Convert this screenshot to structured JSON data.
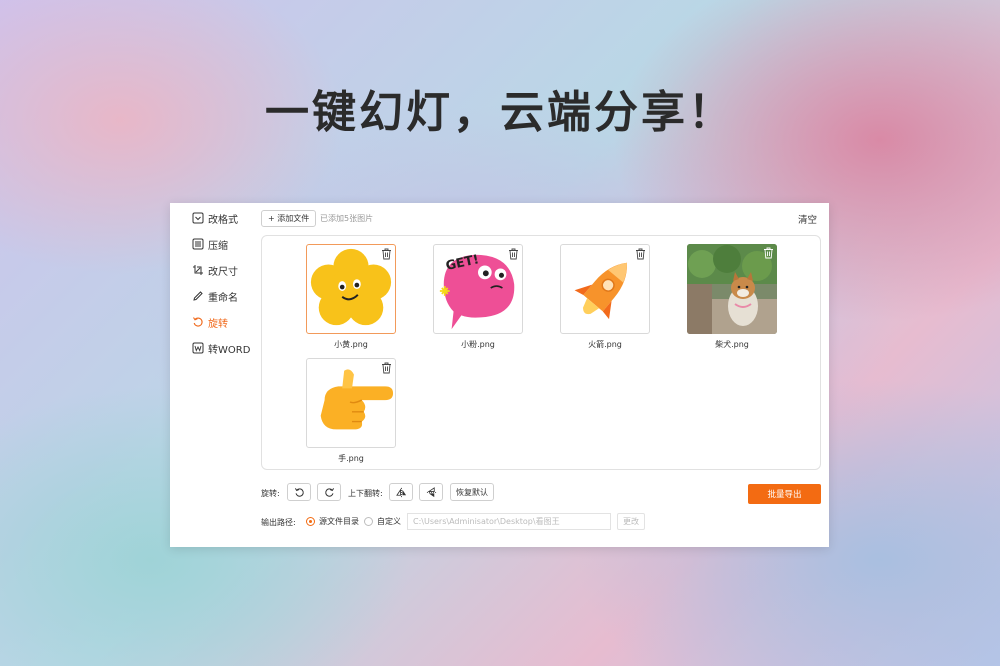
{
  "headline": "一键幻灯，云端分享！",
  "sidebar": {
    "items": [
      {
        "label": "改格式",
        "icon": "format-icon",
        "active": false
      },
      {
        "label": "压缩",
        "icon": "compress-icon",
        "active": false
      },
      {
        "label": "改尺寸",
        "icon": "resize-icon",
        "active": false
      },
      {
        "label": "重命名",
        "icon": "rename-pen-icon",
        "active": false
      },
      {
        "label": "旋转",
        "icon": "rotate-icon",
        "active": true
      },
      {
        "label": "转WORD",
        "icon": "word-icon",
        "active": false
      }
    ]
  },
  "toolbar": {
    "add_file_label": "+ 添加文件",
    "count_text": "已添加5张图片",
    "clear_label": "清空"
  },
  "files": [
    {
      "name": "小黄.png",
      "icon": "yellow-flower-sticker",
      "selected": true
    },
    {
      "name": "小粉.png",
      "icon": "pink-get-sticker",
      "selected": false
    },
    {
      "name": "火箭.png",
      "icon": "rocket-sticker",
      "selected": false
    },
    {
      "name": "柴犬.png",
      "icon": "shiba-photo",
      "selected": false
    },
    {
      "name": "手.png",
      "icon": "pointing-hand-sticker",
      "selected": false
    }
  ],
  "controls": {
    "rotate_label": "旋转:",
    "flip_label": "上下翻转:",
    "reset_label": "恢复默认",
    "export_label": "批量导出",
    "output_label": "输出路径:",
    "source_dir_label": "源文件目录",
    "custom_label": "自定义",
    "path_placeholder": "C:\\Users\\Adminisator\\Desktop\\看图王",
    "change_label": "更改"
  },
  "colors": {
    "accent": "#f36b12",
    "text": "#333333"
  }
}
